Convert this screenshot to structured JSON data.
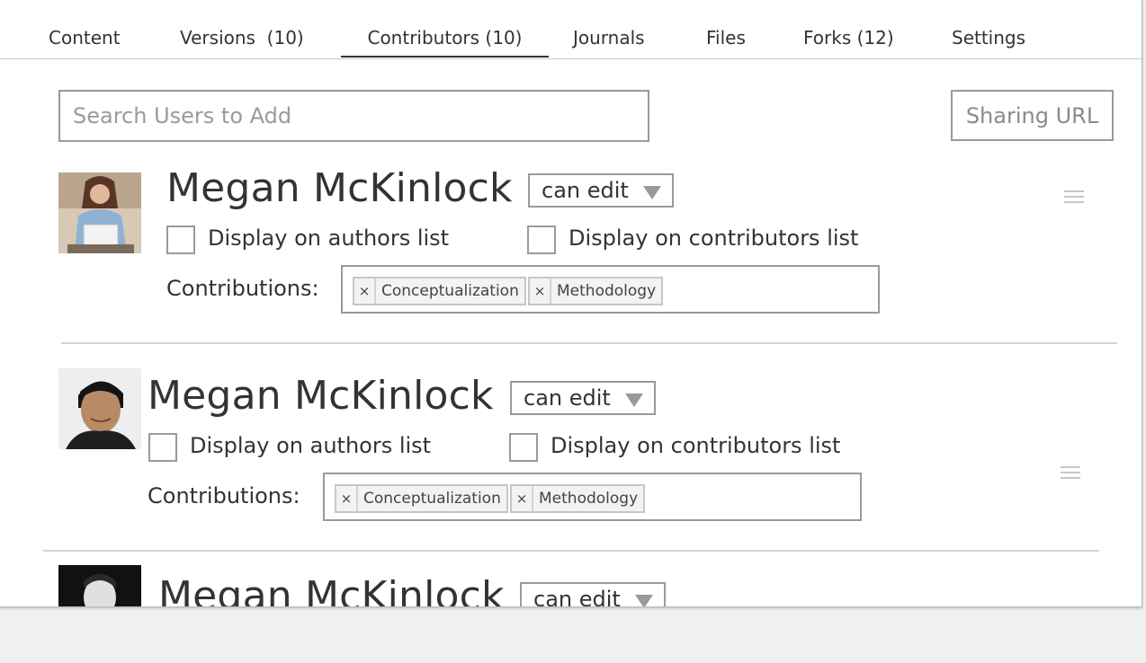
{
  "tabs": [
    {
      "label": "Content"
    },
    {
      "label": "Versions  (10)"
    },
    {
      "label": "Contributors (10)",
      "active": true
    },
    {
      "label": "Journals"
    },
    {
      "label": "Files"
    },
    {
      "label": "Forks (12)"
    },
    {
      "label": "Settings"
    }
  ],
  "search": {
    "placeholder": "Search Users to Add"
  },
  "sharing_button": {
    "label": "Sharing URL"
  },
  "contributors": [
    {
      "name": "Megan McKinlock",
      "permission": "can edit",
      "authors_label": "Display on authors list",
      "contributors_label": "Display on contributors list",
      "contributions_label": "Contributions:",
      "tags": [
        {
          "remove": "×",
          "text": "Conceptualization"
        },
        {
          "remove": "×",
          "text": "Methodology"
        }
      ]
    },
    {
      "name": "Megan McKinlock",
      "permission": "can edit",
      "authors_label": "Display on authors list",
      "contributors_label": "Display on contributors list",
      "contributions_label": "Contributions:",
      "tags": [
        {
          "remove": "×",
          "text": "Conceptualization"
        },
        {
          "remove": "×",
          "text": "Methodology"
        }
      ]
    },
    {
      "name": "Megan McKinlock",
      "permission": "can edit"
    }
  ],
  "colors": {
    "border": "#9a9a9a",
    "text": "#333333",
    "tag_bg": "#f3f3f3",
    "backdrop": "#f0f0f0"
  }
}
